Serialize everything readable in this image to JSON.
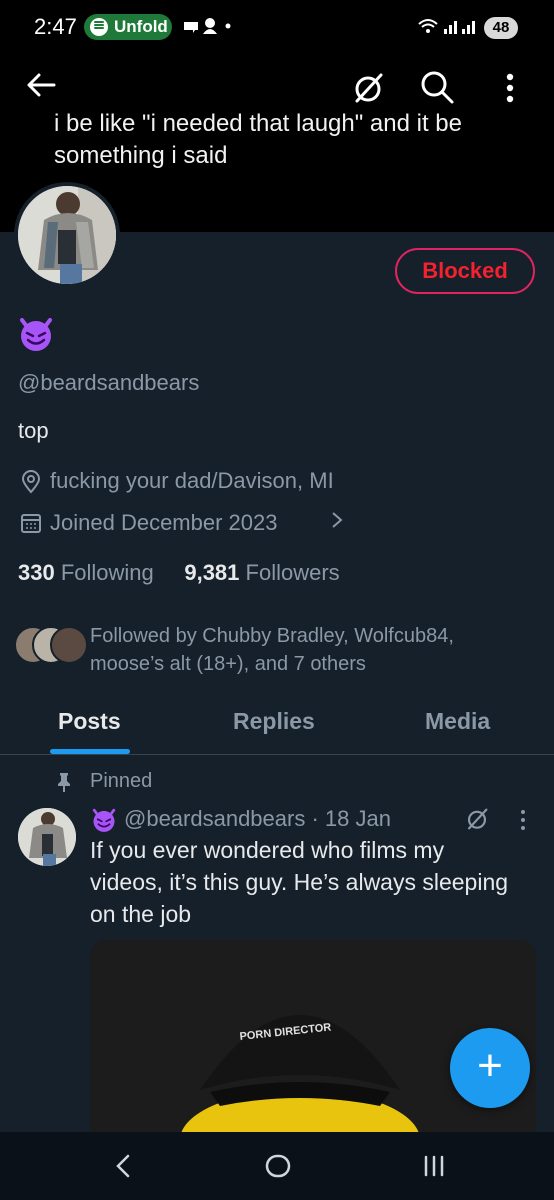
{
  "status_bar": {
    "time": "2:47",
    "spotify_label": "Unfold",
    "battery": "48"
  },
  "banner": {
    "text": "i be like \"i needed that laugh\" and it be something i said"
  },
  "profile": {
    "blocked_label": "Blocked",
    "handle": "@beardsandbears",
    "bio": "top",
    "location": "fucking your dad/Davison, MI",
    "joined": "Joined December 2023",
    "following_count": "330",
    "following_label": "Following",
    "followers_count": "9,381",
    "followers_label": "Followers",
    "followed_by": "Followed by Chubby Bradley, Wolfcub84, moose’s alt (18+), and 7 others"
  },
  "tabs": [
    {
      "label": "Posts",
      "active": true
    },
    {
      "label": "Replies",
      "active": false
    },
    {
      "label": "Media",
      "active": false
    }
  ],
  "post": {
    "pinned_label": "Pinned",
    "handle_date": "@beardsandbears · 18 Jan",
    "text": "If you ever wondered who films my videos, it’s this guy. He’s always sleeping on the job",
    "hat_text": "PORN DIRECTOR"
  },
  "fab": {
    "label": "+"
  },
  "colors": {
    "background": "#15202b",
    "accent": "#1d9bf0",
    "blocked": "#f4212e",
    "muted": "#8b98a5"
  }
}
